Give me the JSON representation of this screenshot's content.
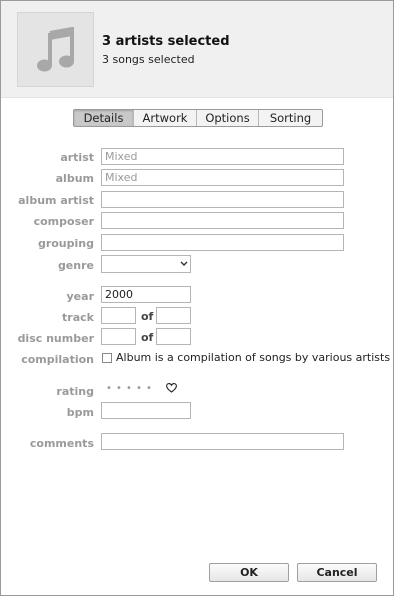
{
  "header": {
    "title": "3 artists selected",
    "subtitle": "3 songs selected",
    "artwork_icon": "music-note-icon"
  },
  "tabs": [
    {
      "label": "Details",
      "active": true
    },
    {
      "label": "Artwork",
      "active": false
    },
    {
      "label": "Options",
      "active": false
    },
    {
      "label": "Sorting",
      "active": false
    }
  ],
  "fields": {
    "artist": {
      "label": "artist",
      "placeholder": "Mixed",
      "value": ""
    },
    "album": {
      "label": "album",
      "placeholder": "Mixed",
      "value": ""
    },
    "album_artist": {
      "label": "album artist",
      "value": ""
    },
    "composer": {
      "label": "composer",
      "value": ""
    },
    "grouping": {
      "label": "grouping",
      "value": ""
    },
    "genre": {
      "label": "genre",
      "value": ""
    },
    "year": {
      "label": "year",
      "value": "2000"
    },
    "track": {
      "label": "track",
      "value": "",
      "of_label": "of",
      "of_value": ""
    },
    "disc_number": {
      "label": "disc number",
      "value": "",
      "of_label": "of",
      "of_value": ""
    },
    "compilation": {
      "label": "compilation",
      "checkbox_label": "Album is a compilation of songs by various artists",
      "checked": false
    },
    "rating": {
      "label": "rating",
      "dots": [
        "•",
        "•",
        "•",
        "•",
        "•"
      ],
      "value": 0
    },
    "bpm": {
      "label": "bpm",
      "value": ""
    },
    "comments": {
      "label": "comments",
      "value": ""
    }
  },
  "buttons": {
    "ok": "OK",
    "cancel": "Cancel"
  },
  "colors": {
    "header_bg": "#f0f0f0",
    "label_gray": "#9a9a9a",
    "active_tab": "#c9c9c9"
  }
}
